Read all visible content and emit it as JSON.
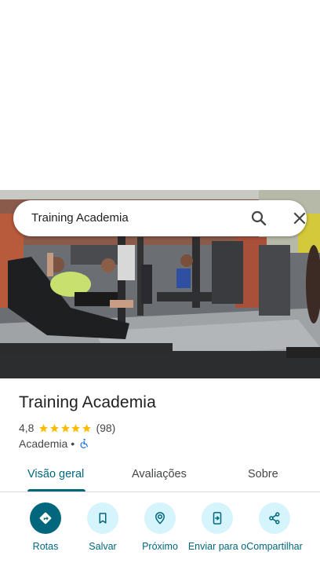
{
  "search": {
    "query": "Training Academia"
  },
  "place": {
    "name": "Training Academia",
    "rating": "4,8",
    "stars": 5,
    "review_count": "(98)",
    "category": "Academia",
    "separator": "•"
  },
  "tabs": [
    {
      "label": "Visão geral",
      "active": true
    },
    {
      "label": "Avaliações",
      "active": false
    },
    {
      "label": "Sobre",
      "active": false
    }
  ],
  "actions": [
    {
      "label": "Rotas",
      "icon": "directions-icon"
    },
    {
      "label": "Salvar",
      "icon": "bookmark-icon"
    },
    {
      "label": "Próximo",
      "icon": "nearby-icon"
    },
    {
      "label": "Enviar para o",
      "icon": "send-to-phone-icon"
    },
    {
      "label": "Compartilhar",
      "icon": "share-icon"
    }
  ],
  "colors": {
    "accent": "#00677d",
    "action_bg": "#d6f4fb",
    "star": "#fbbc04"
  }
}
